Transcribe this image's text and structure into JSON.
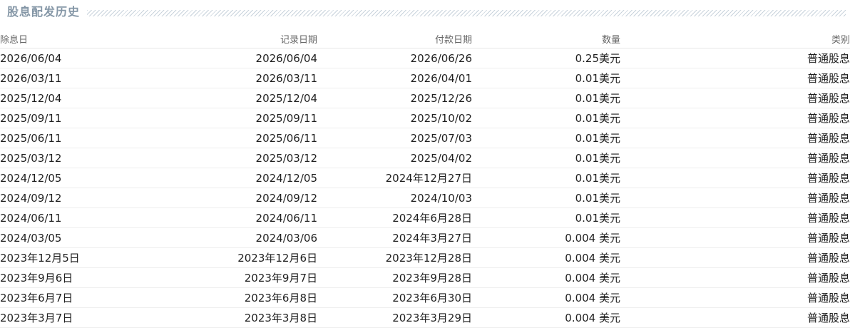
{
  "section": {
    "title": "股息配发历史"
  },
  "table": {
    "headers": [
      "除息日",
      "记录日期",
      "付款日期",
      "数量",
      "类别"
    ],
    "rows": [
      [
        "2026/06/04",
        "2026/06/04",
        "2026/06/26",
        "0.25美元",
        "普通股息"
      ],
      [
        "2026/03/11",
        "2026/03/11",
        "2026/04/01",
        "0.01美元",
        "普通股息"
      ],
      [
        "2025/12/04",
        "2025/12/04",
        "2025/12/26",
        "0.01美元",
        "普通股息"
      ],
      [
        "2025/09/11",
        "2025/09/11",
        "2025/10/02",
        "0.01美元",
        "普通股息"
      ],
      [
        "2025/06/11",
        "2025/06/11",
        "2025/07/03",
        "0.01美元",
        "普通股息"
      ],
      [
        "2025/03/12",
        "2025/03/12",
        "2025/04/02",
        "0.01美元",
        "普通股息"
      ],
      [
        "2024/12/05",
        "2024/12/05",
        "2024年12月27日",
        "0.01美元",
        "普通股息"
      ],
      [
        "2024/09/12",
        "2024/09/12",
        "2024/10/03",
        "0.01美元",
        "普通股息"
      ],
      [
        "2024/06/11",
        "2024/06/11",
        "2024年6月28日",
        "0.01美元",
        "普通股息"
      ],
      [
        "2024/03/05",
        "2024/03/06",
        "2024年3月27日",
        "0.004 美元",
        "普通股息"
      ],
      [
        "2023年12月5日",
        "2023年12月6日",
        "2023年12月28日",
        "0.004 美元",
        "普通股息"
      ],
      [
        "2023年9月6日",
        "2023年9月7日",
        "2023年9月28日",
        "0.004 美元",
        "普通股息"
      ],
      [
        "2023年6月7日",
        "2023年6月8日",
        "2023年6月30日",
        "0.004 美元",
        "普通股息"
      ],
      [
        "2023年3月7日",
        "2023年3月8日",
        "2023年3月29日",
        "0.004 美元",
        "普通股息"
      ]
    ]
  }
}
